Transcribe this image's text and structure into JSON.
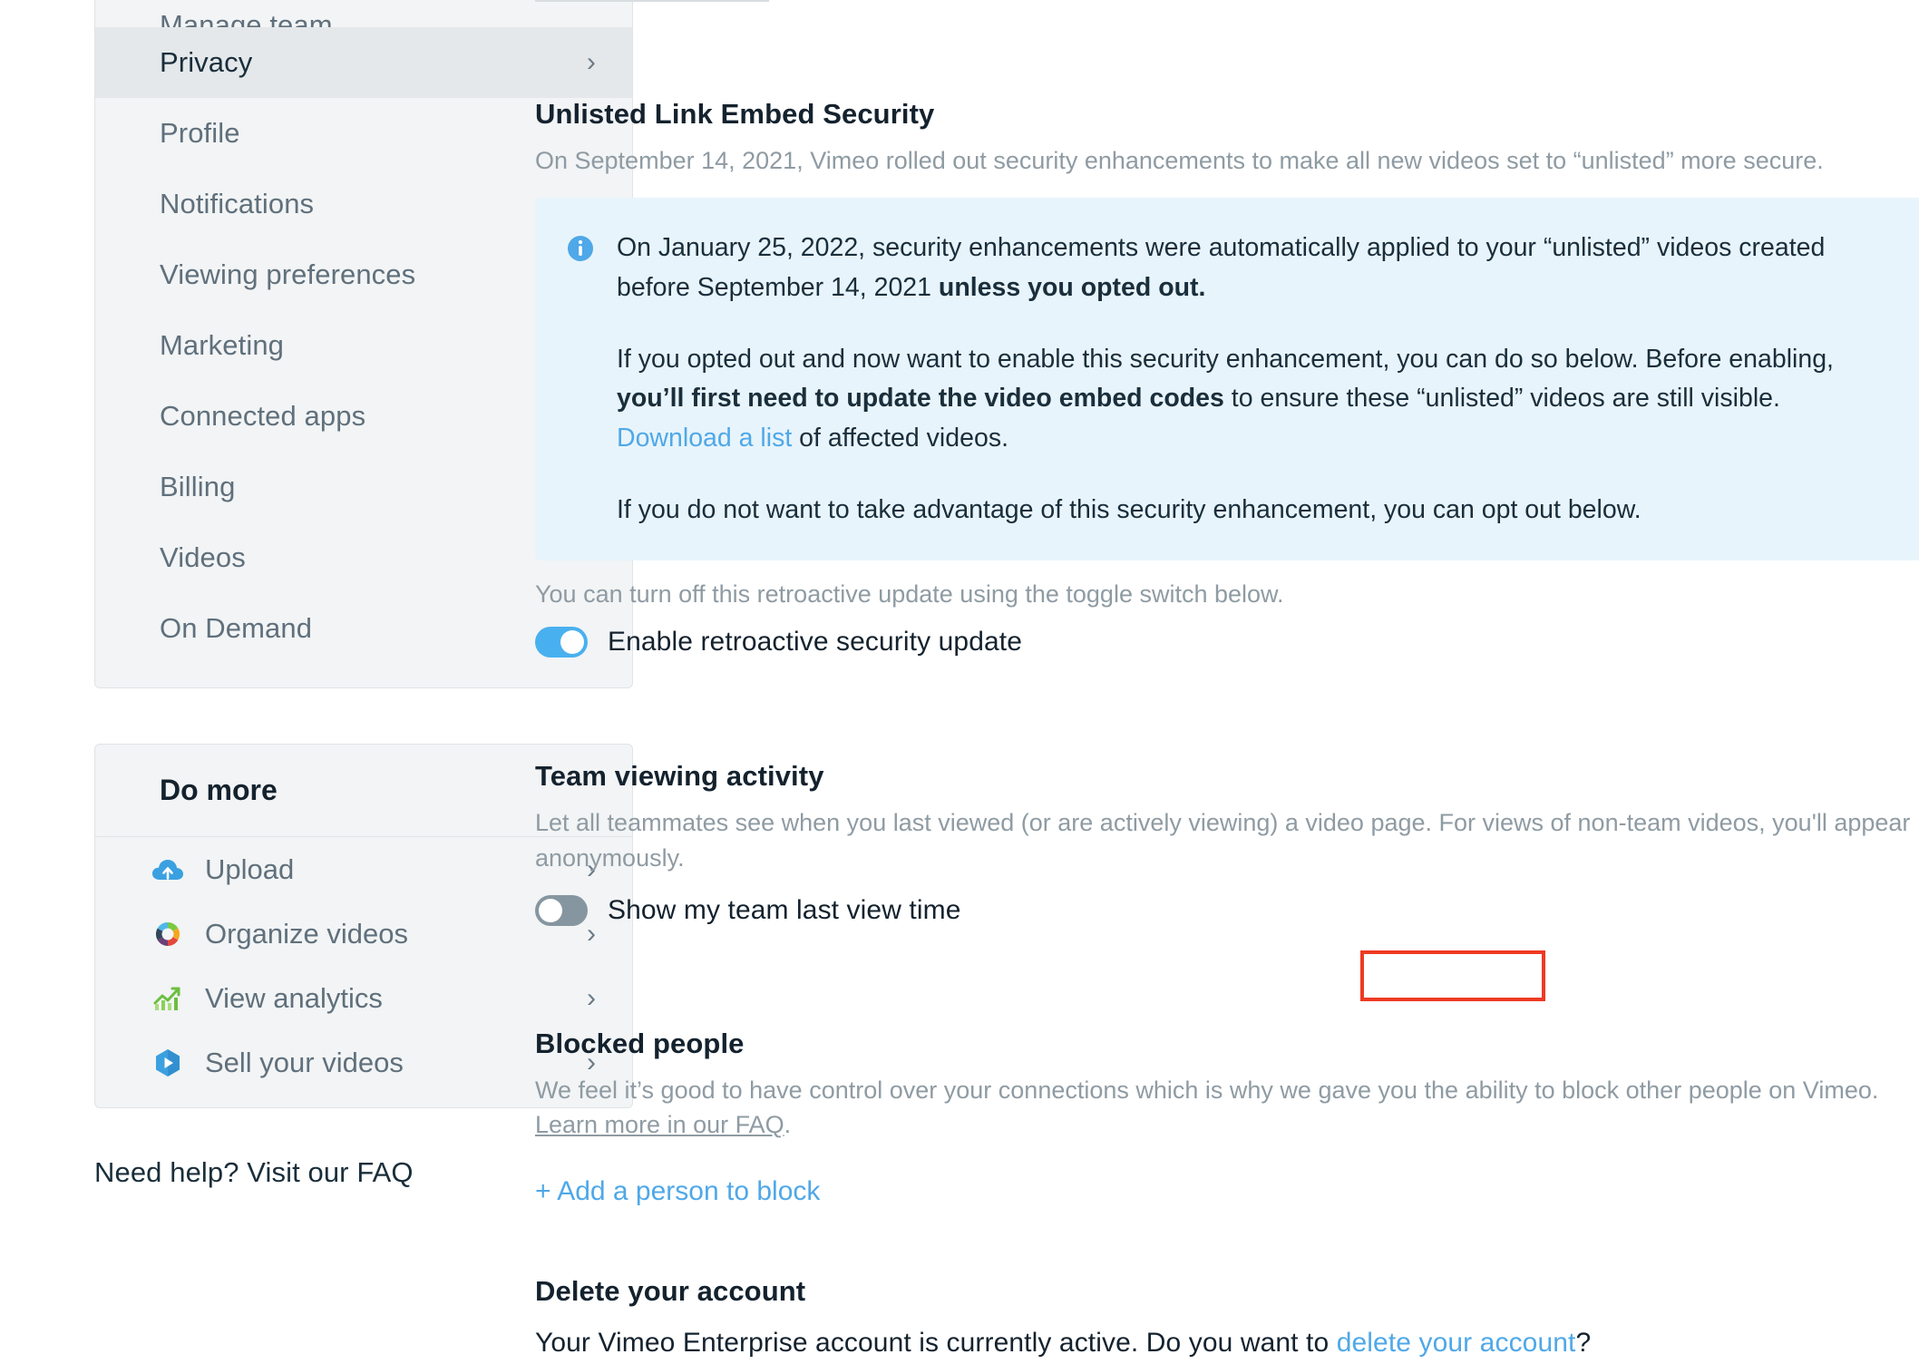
{
  "sidebar": {
    "nav_items": [
      {
        "label": "Manage team",
        "active": false,
        "partial": true,
        "chevron": false
      },
      {
        "label": "Privacy",
        "active": true,
        "partial": false,
        "chevron": true
      },
      {
        "label": "Profile",
        "active": false,
        "partial": false,
        "chevron": false
      },
      {
        "label": "Notifications",
        "active": false,
        "partial": false,
        "chevron": false
      },
      {
        "label": "Viewing preferences",
        "active": false,
        "partial": false,
        "chevron": false
      },
      {
        "label": "Marketing",
        "active": false,
        "partial": false,
        "chevron": false
      },
      {
        "label": "Connected apps",
        "active": false,
        "partial": false,
        "chevron": false
      },
      {
        "label": "Billing",
        "active": false,
        "partial": false,
        "chevron": false
      },
      {
        "label": "Videos",
        "active": false,
        "partial": false,
        "chevron": false
      },
      {
        "label": "On Demand",
        "active": false,
        "partial": false,
        "chevron": false
      }
    ],
    "do_more": {
      "title": "Do more",
      "items": [
        {
          "label": "Upload",
          "icon": "cloud-upload-icon"
        },
        {
          "label": "Organize videos",
          "icon": "color-wheel-icon"
        },
        {
          "label": "View analytics",
          "icon": "analytics-chart-icon"
        },
        {
          "label": "Sell your videos",
          "icon": "play-hexagon-icon"
        }
      ]
    },
    "faq_text": "Need help? Visit our FAQ"
  },
  "main": {
    "unlisted": {
      "title": "Unlisted Link Embed Security",
      "description": "On September 14, 2021, Vimeo rolled out security enhancements to make all new videos set to “unlisted” more secure.",
      "info": {
        "icon": "info-circle-icon",
        "p1_a": "On January 25, 2022, security enhancements were automatically applied to your “unlisted” videos created before September 14, 2021 ",
        "p1_bold": "unless you opted out.",
        "p2_a": "If you opted out and now want to enable this security enhancement, you can do so below. Before enabling, ",
        "p2_bold": "you’ll first need to update the video embed codes",
        "p2_b": " to ensure these “unlisted” videos are still visible. ",
        "p2_link": "Download a list",
        "p2_c": " of affected videos.",
        "p3": "If you do not want to take advantage of this security enhancement, you can opt out below."
      },
      "helper_text": "You can turn off this retroactive update using the toggle switch below.",
      "toggle_label": "Enable retroactive security update",
      "toggle_state": "on"
    },
    "team_viewing": {
      "title": "Team viewing activity",
      "description_line1": "Let all teammates see when you last viewed (or are actively viewing) a video page. For views of non-team videos, you'll appear",
      "description_line2": "anonymously.",
      "toggle_label": "Show my team last view time",
      "toggle_state": "off"
    },
    "blocked_people": {
      "title": "Blocked people",
      "description_line1": "We feel it’s good to have control over your connections which is why we gave you the ability to block other people on Vimeo.",
      "description_link": "Learn more in our FAQ",
      "description_period": ".",
      "add_link": "+ Add a person to block"
    },
    "delete_account": {
      "title": "Delete your account",
      "text_before": "Your Vimeo Enterprise account is currently active. Do you want to ",
      "link": "delete your account",
      "text_after": "?"
    }
  },
  "colors": {
    "accent_link": "#4fa8e8",
    "info_bg": "#e8f4fb",
    "toggle_on": "#49b0f0",
    "toggle_off": "#8696a1",
    "highlight_border": "#ee3a22"
  }
}
